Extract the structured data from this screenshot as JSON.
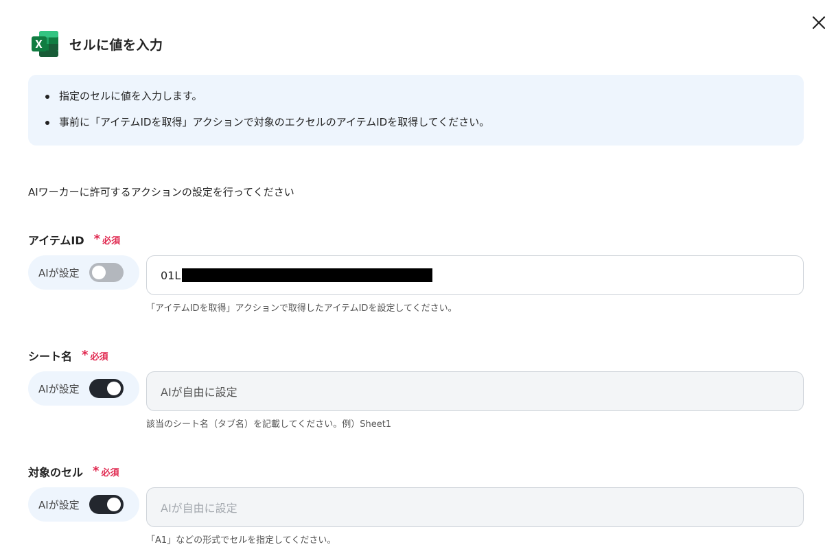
{
  "header": {
    "title": "セルに値を入力",
    "app_icon": "excel-icon",
    "close_icon": "close-icon"
  },
  "info": {
    "items": [
      "指定のセルに値を入力します。",
      "事前に「アイテムIDを取得」アクションで対象のエクセルのアイテムIDを取得してください。"
    ]
  },
  "subtitle": "AIワーカーに許可するアクションの設定を行ってください",
  "fields": [
    {
      "label": "アイテムID",
      "required": "必須",
      "ai_label": "AIが設定",
      "ai_enabled": false,
      "value": "01L",
      "value_redacted": true,
      "hint": "「アイテムIDを取得」アクションで取得したアイテムIDを設定してください。"
    },
    {
      "label": "シート名",
      "required": "必須",
      "ai_label": "AIが設定",
      "ai_enabled": true,
      "value": "AIが自由に設定",
      "hint": "該当のシート名（タブ名）を記載してください。例）Sheet1"
    },
    {
      "label": "対象のセル",
      "required": "必須",
      "ai_label": "AIが設定",
      "ai_enabled": true,
      "value": "AIが自由に設定",
      "hint": "「A1」などの形式でセルを指定してください。"
    }
  ],
  "colors": {
    "accent_bg": "#eef5fd",
    "required": "#e0284f",
    "toggle_on": "#23272e",
    "toggle_off": "#b3b7bd",
    "excel_green": "#1d7b45"
  }
}
